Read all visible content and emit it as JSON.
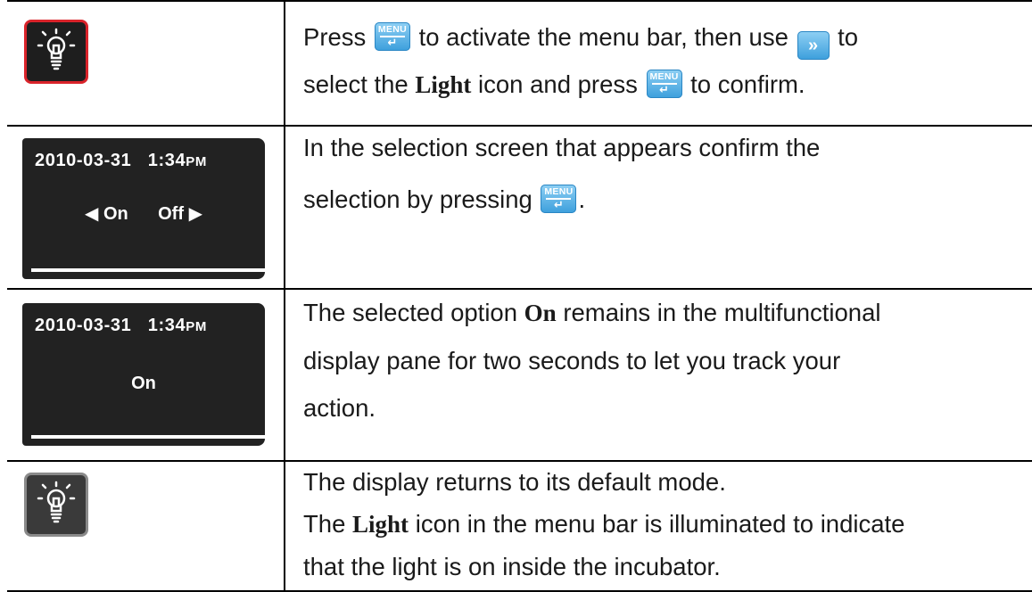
{
  "rows": [
    {
      "icon": "light-bulb-icon",
      "icon_state": "selected",
      "text": {
        "l1a": "Press",
        "l1b": "to activate the menu bar, then use",
        "l1c": "to",
        "l2a": "select the",
        "l2b": "Light",
        "l2c": "icon and press",
        "l2d": "to confirm."
      }
    },
    {
      "screen": {
        "date": "2010-03-31",
        "time": "1:34",
        "ampm": "PM",
        "option_left": "On",
        "option_right": "Off"
      },
      "text": {
        "l1": "In the selection screen that appears confirm the",
        "l2a": "selection by pressing",
        "l2b": "."
      }
    },
    {
      "screen": {
        "date": "2010-03-31",
        "time": "1:34",
        "ampm": "PM",
        "option": "On"
      },
      "text": {
        "l1a": "The selected option",
        "l1b": "On",
        "l1c": "remains in the multifunctional",
        "l2": "display pane for two seconds to let you track your",
        "l3": "action."
      }
    },
    {
      "icon": "light-bulb-icon",
      "icon_state": "illuminated",
      "text": {
        "l1": "The display returns to its default mode.",
        "l2a": "The",
        "l2b": "Light",
        "l2c": "icon in the menu bar is illuminated to indicate",
        "l3": "that the light is on inside the incubator."
      }
    }
  ],
  "keys": {
    "menu_label": "MENU",
    "menu_arrow": "↵",
    "next_arrow": "»"
  },
  "colors": {
    "selected_border": "#d9232a",
    "key_blue": "#3c9fdc",
    "screen_bg": "#222222"
  }
}
